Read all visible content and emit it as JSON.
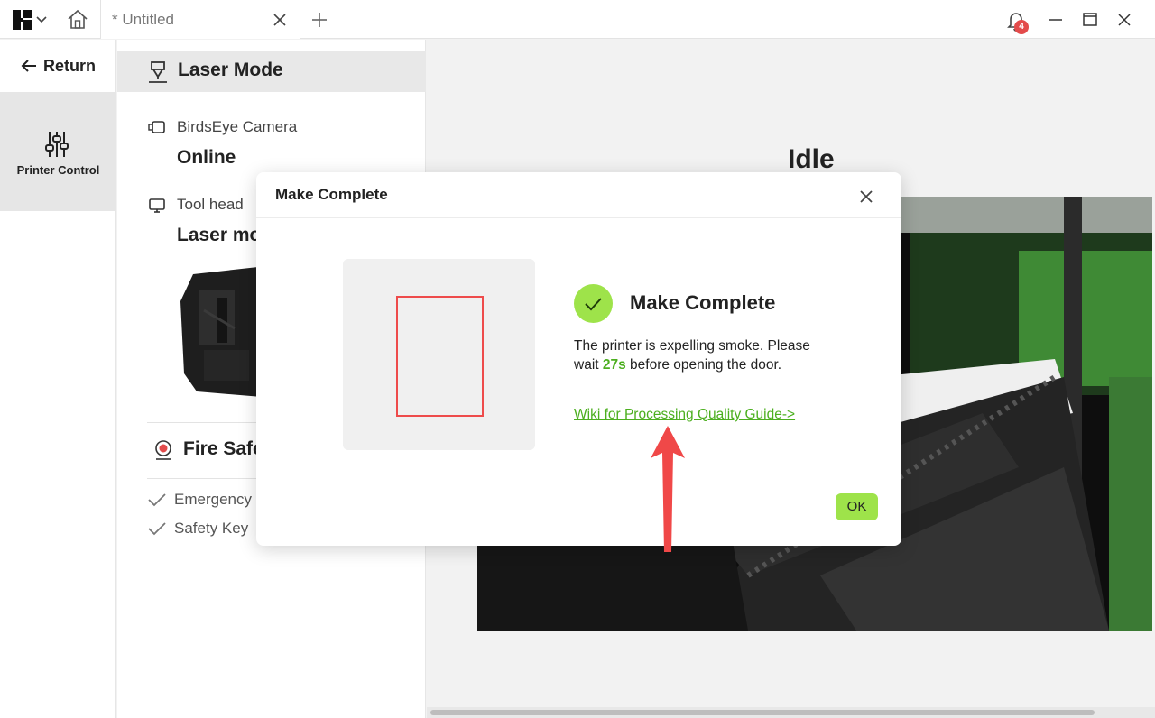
{
  "titlebar": {
    "tab_title": "* Untitled",
    "notification_count": "4",
    "icons": [
      "app-logo-icon",
      "chevron-down-icon",
      "home-icon",
      "close-icon",
      "plus-icon",
      "bell-icon",
      "minimize-icon",
      "maximize-icon",
      "close-icon"
    ]
  },
  "leftnav": {
    "return_label": "Return",
    "printer_control_label": "Printer Control"
  },
  "panel": {
    "mode_title": "Laser Mode",
    "camera_label": "BirdsEye Camera",
    "camera_status": "Online",
    "toolhead_label": "Tool head",
    "toolhead_value": "Laser mo",
    "fire_title": "Fire Safe",
    "checks": [
      "Emergency",
      "Safety Key"
    ]
  },
  "main": {
    "status": "Idle"
  },
  "modal": {
    "title": "Make Complete",
    "heading": "Make Complete",
    "msg_part1": "The printer is expelling smoke. Please wait ",
    "msg_wait": "27s",
    "msg_part2": " before opening the door.",
    "wiki_link": "Wiki for Processing Quality Guide->",
    "ok_label": "OK"
  },
  "colors": {
    "accent_green": "#9ee34a",
    "link_green": "#4caf1f",
    "preview_red": "#ee4b4b",
    "badge_red": "#e34b4b",
    "annotation_red": "#f04848"
  }
}
